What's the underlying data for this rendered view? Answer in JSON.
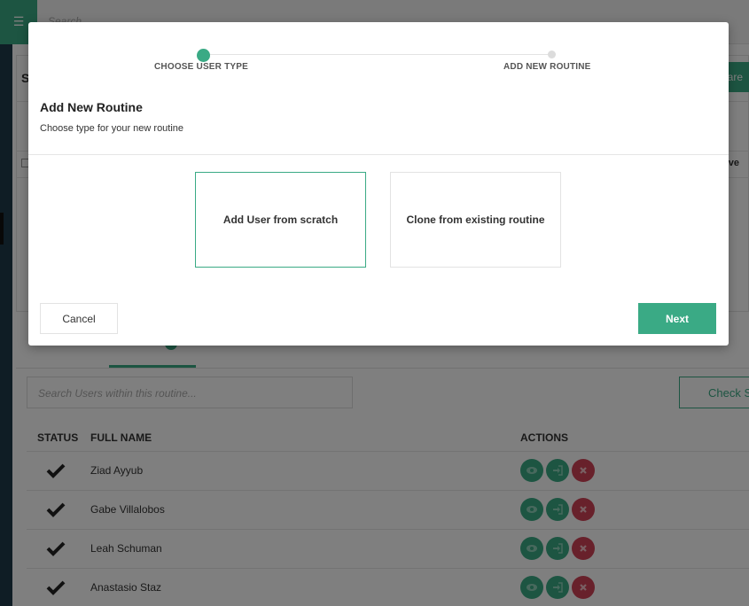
{
  "topbar": {
    "menu_icon": "☰",
    "search_placeholder": "Search"
  },
  "background_panel": {
    "title_fragment": "S",
    "button_fragment": "pare",
    "column_fragment": "tive"
  },
  "users": {
    "search_placeholder": "Search Users within this routine...",
    "check_button_label": "Check St",
    "columns": {
      "status": "STATUS",
      "full_name": "FULL NAME",
      "actions": "ACTIONS"
    },
    "rows": [
      {
        "name": "Ziad Ayyub"
      },
      {
        "name": "Gabe Villalobos"
      },
      {
        "name": "Leah Schuman"
      },
      {
        "name": "Anastasio Staz"
      }
    ],
    "action_icons": [
      "eye-icon",
      "sign-in-icon",
      "close-icon"
    ]
  },
  "modal": {
    "steps": [
      {
        "label": "CHOOSE USER TYPE",
        "active": true
      },
      {
        "label": "ADD NEW ROUTINE",
        "active": false
      }
    ],
    "title": "Add New Routine",
    "subtitle": "Choose type for your new routine",
    "options": [
      {
        "label": "Add User from scratch",
        "selected": true
      },
      {
        "label": "Clone from existing routine",
        "selected": false
      }
    ],
    "cancel_label": "Cancel",
    "next_label": "Next"
  },
  "colors": {
    "accent": "#3aaa85",
    "danger": "#d04356",
    "overlay": "rgba(0,0,0,0.5)"
  }
}
